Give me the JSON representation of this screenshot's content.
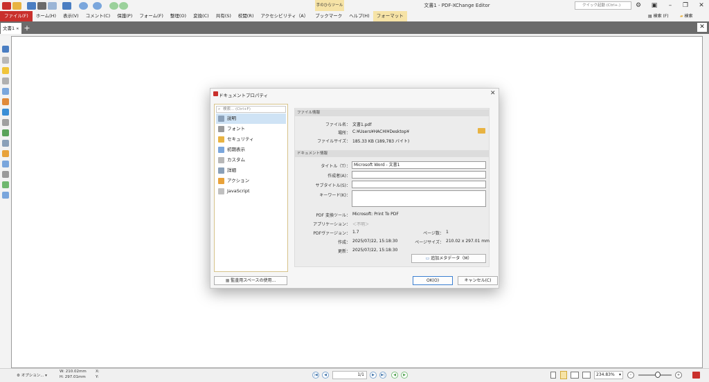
{
  "window": {
    "title": "文書1 - PDF-XChange Editor"
  },
  "ribbon": {
    "tool_group": "手のひらツール"
  },
  "menu": [
    "ファイル(F)",
    "ホーム(H)",
    "表示(V)",
    "コメント(C)",
    "保護(P)",
    "フォーム(F)",
    "整理(O)",
    "変換(C)",
    "共有(S)",
    "校閲(R)",
    "アクセシビリティ（A）",
    "ブックマーク",
    "ヘルプ(H)",
    "フォーマット"
  ],
  "search": {
    "placeholder": "クイック起動 (Ctrl+.)"
  },
  "right_buttons": {
    "find": "検索 (F)",
    "search": "検索"
  },
  "tab": {
    "label": "文書1"
  },
  "dialog": {
    "title": "ドキュメントプロパティ",
    "search_placeholder": "検索... (Ctrl+F)",
    "categories": [
      "説明",
      "フォント",
      "セキュリティ",
      "初期表示",
      "カスタム",
      "詳細",
      "アクション",
      "JavaScript"
    ],
    "selected_category": "説明",
    "file_info": {
      "heading": "ファイル情報",
      "name_label": "ファイル名：",
      "name": "文書1.pdf",
      "location_label": "場所：",
      "location": "C:¥Users¥HACHI¥Desktop¥",
      "size_label": "ファイルサイズ：",
      "size": "185.33 KB (189,783 バイト)"
    },
    "doc_info": {
      "heading": "ドキュメント情報",
      "title_label": "タイトル（T）：",
      "title_value": "Microsoft Word - 文書1",
      "author_label": "作成者(A)：",
      "author_value": "",
      "subtitle_label": "サブタイトル(S)：",
      "subtitle_value": "",
      "keywords_label": "キーワード(K)：",
      "keywords_value": "",
      "producer_label": "PDF 変換ツール：",
      "producer": "Microsoft: Print To PDF",
      "app_label": "アプリケーション：",
      "app": "＜不明＞",
      "version_label": "PDFヴァージョン：",
      "version": "1.7",
      "pages_label": "ページ数：",
      "pages": "1",
      "created_label": "作成：",
      "created": "2025/07/22, 15:18:30",
      "pagesize_label": "ページサイズ：",
      "pagesize": "210.02 x 297.01 mm",
      "modified_label": "更新：",
      "modified": "2025/07/22, 15:18:30",
      "metadata_button": "追加メタデータ（M）"
    },
    "monitor_button": "監査用スペースの使用...",
    "ok": "OK(O)",
    "cancel": "キャンセル(C)"
  },
  "status": {
    "options": "オプション...",
    "width": "W: 210.02mm",
    "height": "H: 297.01mm",
    "x": "X:",
    "y": "Y:",
    "page": "1/1",
    "zoom": "234.83%"
  }
}
